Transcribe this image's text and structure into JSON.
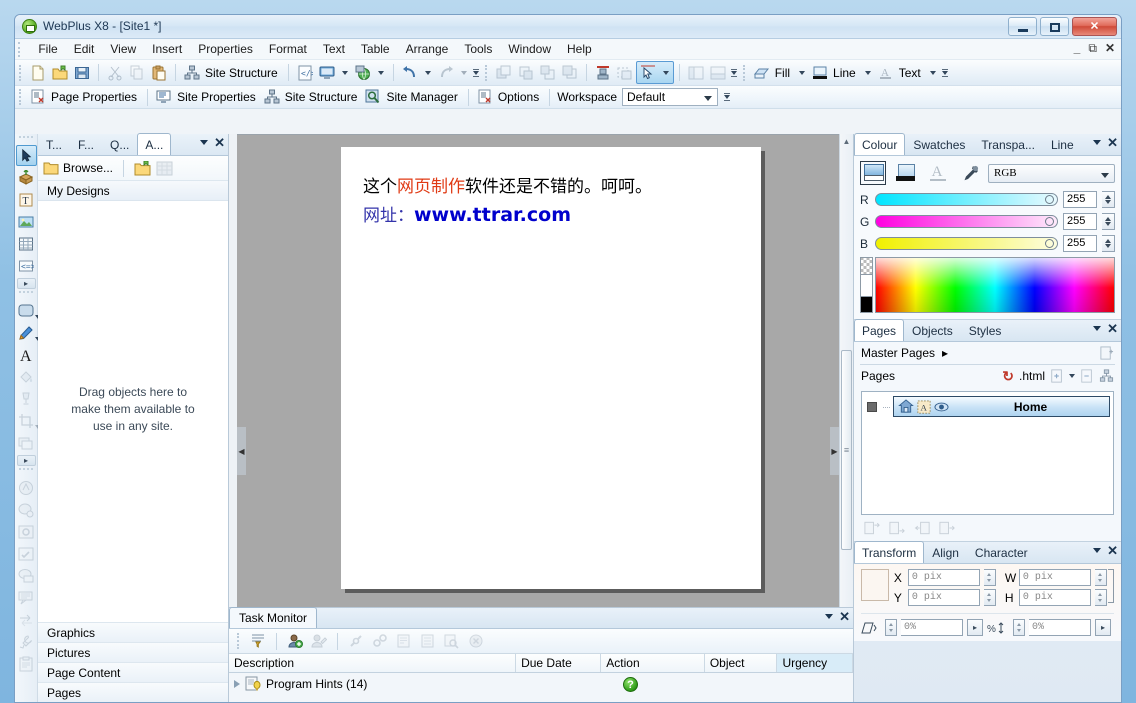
{
  "window": {
    "title": "WebPlus X8 - [Site1 *]",
    "icon": "webplus-app-icon",
    "minimize": "minimize",
    "maximize": "maximize",
    "close": "close",
    "mdi_minimize": "_",
    "mdi_restore": "restore",
    "mdi_close": "close"
  },
  "menu": {
    "items": [
      "File",
      "Edit",
      "View",
      "Insert",
      "Properties",
      "Format",
      "Text",
      "Table",
      "Arrange",
      "Tools",
      "Window",
      "Help"
    ]
  },
  "toolbar_standard": {
    "buttons": [
      {
        "name": "new-site",
        "icon": "new-page-icon"
      },
      {
        "name": "open-site",
        "icon": "open-folder-icon"
      },
      {
        "name": "save-site",
        "icon": "save-disk-icon"
      },
      {
        "name": "cut",
        "icon": "scissors-icon"
      },
      {
        "name": "copy",
        "icon": "copy-icon"
      },
      {
        "name": "paste",
        "icon": "paste-icon"
      }
    ],
    "site_structure_label": "Site Structure",
    "preview_label": "",
    "undo_label": "",
    "redo_label": ""
  },
  "toolbar_attributes": {
    "fill_label": "Fill",
    "line_label": "Line",
    "text_label": "Text"
  },
  "toolbar_context": {
    "page_properties": "Page Properties",
    "site_properties": "Site Properties",
    "site_structure": "Site Structure",
    "site_manager": "Site Manager",
    "options": "Options",
    "workspace_label": "Workspace",
    "workspace_value": "Default"
  },
  "left_dock": {
    "tabs": [
      {
        "label": "T...",
        "name": "tab-tab-t"
      },
      {
        "label": "F...",
        "name": "tab-tab-f"
      },
      {
        "label": "Q...",
        "name": "tab-tab-q"
      },
      {
        "label": "A...",
        "name": "tab-assets",
        "active": true
      }
    ],
    "browse_label": "Browse...",
    "my_designs": "My Designs",
    "drop_hint_line1": "Drag objects here to",
    "drop_hint_line2": "make them available to",
    "drop_hint_line3": "use in any site.",
    "bottom_items": [
      "Graphics",
      "Pictures",
      "Page Content",
      "Pages"
    ]
  },
  "left_toolbox": {
    "tools": [
      {
        "name": "pointer-tool",
        "icon": "arrow-cursor-icon",
        "selected": true
      },
      {
        "name": "insert-object-tool",
        "icon": "box-package-icon"
      },
      {
        "name": "text-frame-tool",
        "icon": "text-frame-icon"
      },
      {
        "name": "picture-tool",
        "icon": "picture-icon"
      },
      {
        "name": "table-tool",
        "icon": "table-grid-icon"
      },
      {
        "name": "html-fragment-tool",
        "icon": "code-brackets-icon"
      },
      {
        "name": "shape-tool",
        "icon": "rounded-rect-icon"
      },
      {
        "name": "pencil-tool",
        "icon": "pencil-icon"
      },
      {
        "name": "artistic-text-tool",
        "icon": "letter-a-icon"
      },
      {
        "name": "fill-tool",
        "icon": "paint-bucket-icon"
      },
      {
        "name": "transparency-tool",
        "icon": "goblet-icon"
      },
      {
        "name": "crop-tool",
        "icon": "crop-icon"
      },
      {
        "name": "rollover-tool",
        "icon": "rollover-icon"
      },
      {
        "name": "navbar-tool",
        "icon": "navbar-icon"
      },
      {
        "name": "media-tool",
        "icon": "media-icon"
      },
      {
        "name": "gadget-tool",
        "icon": "gear-window-icon"
      },
      {
        "name": "form-tool",
        "icon": "form-check-icon"
      },
      {
        "name": "comment-tool",
        "icon": "comment-icon"
      },
      {
        "name": "blog-tool",
        "icon": "blog-icon"
      },
      {
        "name": "link-tool",
        "icon": "link-arrows-icon"
      },
      {
        "name": "tools-tool",
        "icon": "wrench-icon"
      },
      {
        "name": "clipboard-tool",
        "icon": "clipboard-icon"
      }
    ]
  },
  "canvas": {
    "page_text": {
      "line1_part1": "这个",
      "line1_highlight": "网页制作",
      "line1_part2": "软件还是不错的。呵呵。",
      "line2_label": "网址：",
      "line2_url": "www.ttrar.com"
    },
    "highlight_color": "#e03a14",
    "url_color": "#0000cc",
    "label_color": "#3333aa",
    "hscroll_thumb": "|||"
  },
  "colour_panel": {
    "tabs": [
      "Colour",
      "Swatches",
      "Transpa...",
      "Line"
    ],
    "active_tab": "Colour",
    "mode": "RGB",
    "targets": [
      {
        "name": "fill-swatch",
        "label": ""
      },
      {
        "name": "line-swatch",
        "label": ""
      },
      {
        "name": "text-swatch",
        "label": "A"
      },
      {
        "name": "eyedropper",
        "label": ""
      }
    ],
    "channels": [
      {
        "label": "R",
        "value": "255"
      },
      {
        "label": "G",
        "value": "255"
      },
      {
        "label": "B",
        "value": "255"
      }
    ]
  },
  "pages_panel": {
    "tabs": [
      "Pages",
      "Objects",
      "Styles"
    ],
    "active_tab": "Pages",
    "master_pages_label": "Master Pages",
    "pages_label": "Pages",
    "html_label": ".html",
    "page_items": [
      {
        "name": "Home",
        "icons": [
          "home-icon",
          "text-a-icon",
          "eye-icon"
        ],
        "selected": true
      }
    ]
  },
  "transform_panel": {
    "tabs": [
      "Transform",
      "Align",
      "Character"
    ],
    "active_tab": "Transform",
    "fields": [
      {
        "label": "X",
        "value": "0 pix"
      },
      {
        "label": "W",
        "value": "0 pix"
      },
      {
        "label": "Y",
        "value": "0 pix"
      },
      {
        "label": "H",
        "value": "0 pix"
      }
    ],
    "shear_value": "0%",
    "rotate_value": "0%"
  },
  "task_monitor": {
    "title": "Task Monitor",
    "columns": [
      "Description",
      "Due Date",
      "Action",
      "Object",
      "Urgency"
    ],
    "rows": [
      {
        "description": "Program Hints (14)",
        "due_date": "",
        "action": "help-green-icon",
        "object": "",
        "urgency": ""
      }
    ]
  }
}
